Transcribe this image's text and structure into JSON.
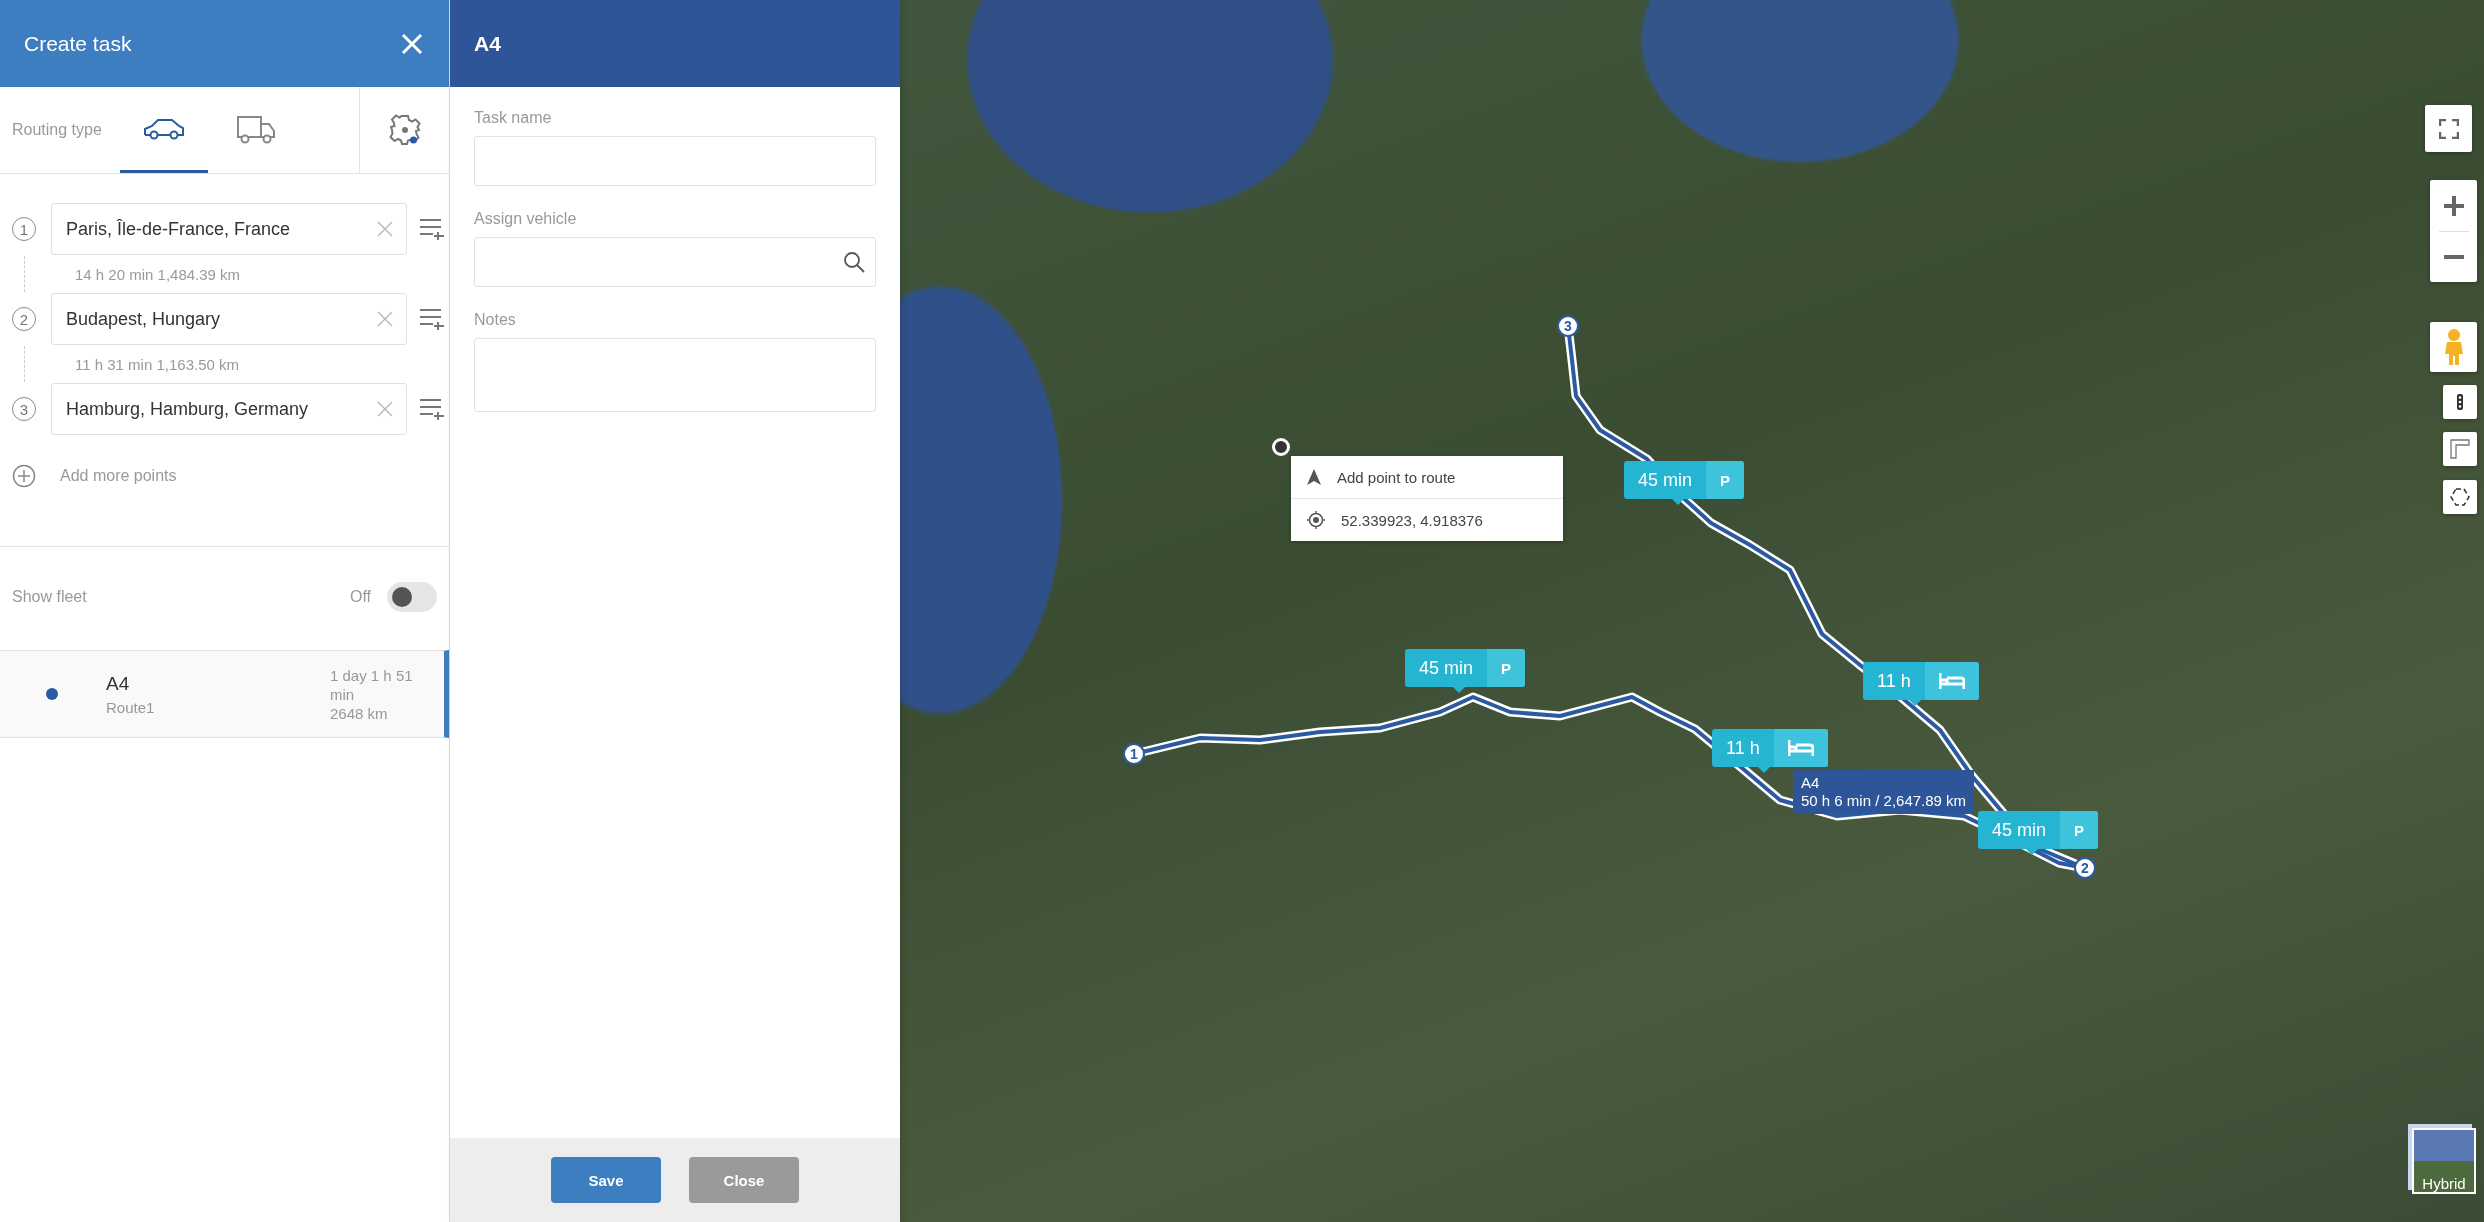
{
  "create_task": {
    "title": "Create task",
    "routing_label": "Routing type",
    "routing_types": [
      {
        "kind": "car",
        "selected": true
      },
      {
        "kind": "truck",
        "selected": false
      }
    ],
    "waypoints": [
      {
        "number": "1",
        "value": "Paris, Île-de-France, France",
        "segment": "14 h 20 min 1,484.39 km"
      },
      {
        "number": "2",
        "value": "Budapest, Hungary",
        "segment": "11 h 31 min 1,163.50 km"
      },
      {
        "number": "3",
        "value": "Hamburg, Hamburg, Germany"
      }
    ],
    "add_points": "Add more points",
    "show_fleet": {
      "label": "Show fleet",
      "state_label": "Off",
      "on": false
    },
    "routes": [
      {
        "name": "A4",
        "subtitle": "Route1",
        "duration": "1 day 1 h 51 min",
        "distance": "2648 km",
        "color": "#2c5aa0",
        "selected": true
      }
    ]
  },
  "task_panel": {
    "title": "A4",
    "fields": [
      {
        "label": "Task name",
        "kind": "text"
      },
      {
        "label": "Assign vehicle",
        "kind": "search"
      },
      {
        "label": "Notes",
        "kind": "textarea"
      }
    ],
    "buttons": [
      {
        "label": "Save",
        "kind": "primary"
      },
      {
        "label": "Close",
        "kind": "secondary"
      }
    ]
  },
  "map": {
    "markers": [
      {
        "number": "1"
      },
      {
        "number": "2"
      },
      {
        "number": "3"
      }
    ],
    "stops": [
      {
        "duration": "45 min",
        "kind": "parking",
        "badge": "P"
      },
      {
        "duration": "45 min",
        "kind": "parking",
        "badge": "P"
      },
      {
        "duration": "11 h",
        "kind": "rest"
      },
      {
        "duration": "11 h",
        "kind": "rest"
      },
      {
        "duration": "45 min",
        "kind": "parking",
        "badge": "P"
      }
    ],
    "route_label": {
      "name": "A4",
      "summary": "50 h 6 min / 2,647.89 km"
    },
    "context_menu": [
      {
        "kind": "action",
        "label": "Add point to route"
      },
      {
        "kind": "coordinates",
        "label": "52.339923, 4.918376"
      }
    ],
    "map_type": "Hybrid"
  }
}
